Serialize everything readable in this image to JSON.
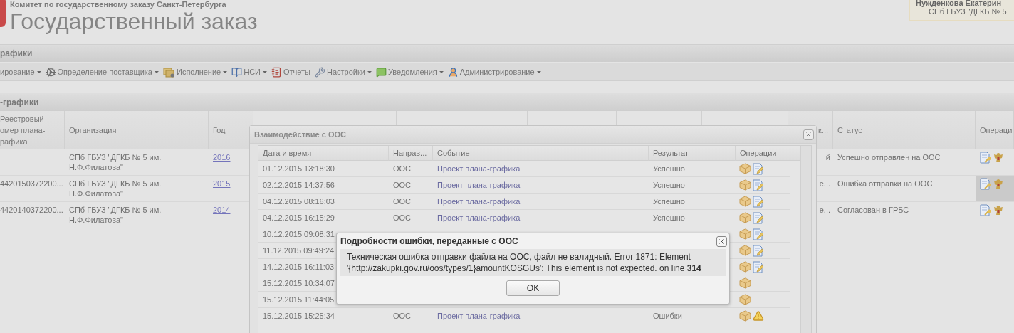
{
  "header": {
    "subtitle": "Комитет по государственному заказу Санкт-Петербурга",
    "title": "Государственный заказ",
    "user": {
      "name": "Нужденкова Екатерин",
      "organization": "СПб ГБУЗ \"ДГКБ № 5"
    }
  },
  "section_title": "рафики",
  "menu": [
    {
      "kind": "plain",
      "label": "ирование",
      "dropdown": true
    },
    {
      "kind": "supplier",
      "label": "Определение поставщика",
      "dropdown": true
    },
    {
      "kind": "execution",
      "label": "Исполнение",
      "dropdown": true
    },
    {
      "kind": "reference",
      "label": "НСИ",
      "dropdown": true
    },
    {
      "kind": "reports",
      "label": "Отчеты",
      "dropdown": false
    },
    {
      "kind": "settings",
      "label": "Настройки",
      "dropdown": true
    },
    {
      "kind": "notifications",
      "label": "Уведомления",
      "dropdown": true
    },
    {
      "kind": "admin",
      "label": "Администрирование",
      "dropdown": true
    }
  ],
  "plan_table": {
    "title": "-графики",
    "columns": [
      "Реестровый\nомер плана-\nрафика",
      "Организация",
      "Год",
      "к...",
      "Статус",
      "Операци"
    ],
    "rows": [
      {
        "organization": "СПб ГБУЗ \"ДГКБ № 5 им.\nН.Ф.Филатова\"",
        "year": "2016",
        "column_4": "й",
        "status": "Успешно отправлен на ООС",
        "selected": false
      },
      {
        "number": "4420150372200...",
        "organization": "СПб ГБУЗ \"ДГКБ № 5 им.\nН.Ф.Филатова\"",
        "year": "2015",
        "column_4": "е...",
        "status": "Ошибка отправки на ООС",
        "selected": true
      },
      {
        "number": "4420140372200...",
        "organization": "СПб ГБУЗ \"ДГКБ № 5 им.\nН.Ф.Филатова\"",
        "year": "2014",
        "column_4": "е...",
        "status": "Согласован в ГРБС",
        "selected": false
      }
    ]
  },
  "interaction_dialog": {
    "title": "Взаимодействие с ООС",
    "columns": [
      "Дата и время",
      "Направ...",
      "Событие",
      "Результат",
      "Операции"
    ],
    "rows": [
      {
        "date": "01.12.2015 13:18:30",
        "direction": "ООС",
        "event": "Проект плана-графика",
        "result": "Успешно",
        "operations": [
          {
            "kind": "package"
          },
          {
            "kind": "edit"
          }
        ]
      },
      {
        "date": "02.12.2015 14:37:56",
        "direction": "ООС",
        "event": "Проект плана-графика",
        "result": "Успешно",
        "operations": [
          {
            "kind": "package"
          },
          {
            "kind": "edit"
          }
        ]
      },
      {
        "date": "04.12.2015 08:16:03",
        "direction": "ООС",
        "event": "Проект плана-графика",
        "result": "Успешно",
        "operations": [
          {
            "kind": "package"
          },
          {
            "kind": "edit"
          }
        ]
      },
      {
        "date": "04.12.2015 16:15:29",
        "direction": "ООС",
        "event": "Проект плана-графика",
        "result": "Успешно",
        "operations": [
          {
            "kind": "package"
          },
          {
            "kind": "edit"
          }
        ]
      },
      {
        "date": "10.12.2015 09:08:31",
        "operations": [
          {
            "kind": "package"
          },
          {
            "kind": "edit"
          }
        ]
      },
      {
        "date": "11.12.2015 09:49:24",
        "operations": [
          {
            "kind": "package"
          },
          {
            "kind": "edit"
          }
        ]
      },
      {
        "date": "14.12.2015 16:11:03",
        "operations": [
          {
            "kind": "package"
          },
          {
            "kind": "edit"
          }
        ]
      },
      {
        "date": "15.12.2015 10:34:07",
        "operations": [
          {
            "kind": "package"
          }
        ]
      },
      {
        "date": "15.12.2015 11:44:05",
        "operations": [
          {
            "kind": "package"
          }
        ]
      },
      {
        "date": "15.12.2015 15:25:34",
        "direction": "ООС",
        "event": "Проект плана-графика",
        "result": "Ошибки",
        "operations": [
          {
            "kind": "package"
          },
          {
            "kind": "warning"
          }
        ]
      }
    ]
  },
  "error_dialog": {
    "title": "Подробности ошибки, переданные с ООС",
    "message": "Техническая ошибка отправки файла на ООС, файл не валидный. Error 1871: Element '{http://zakupki.gov.ru/oos/types/1}amountKOSGUs': This element is not expected. on line **314**",
    "button": "OK"
  }
}
